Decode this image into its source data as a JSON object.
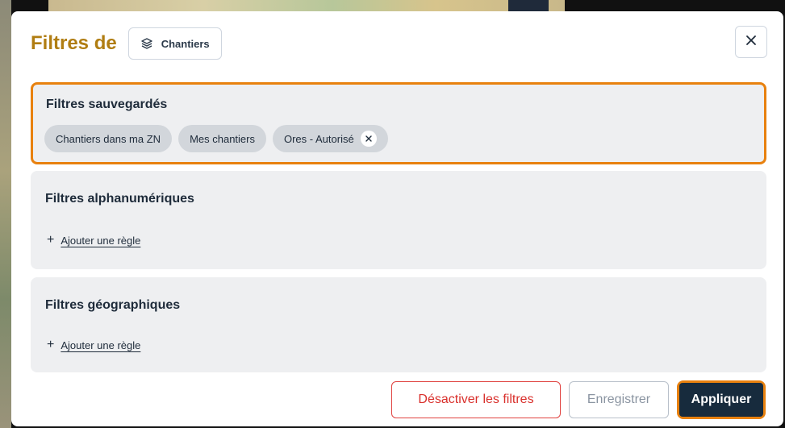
{
  "header": {
    "title": "Filtres de",
    "layer_chip_label": "Chantiers",
    "close_label": "×"
  },
  "saved_filters": {
    "title": "Filtres sauvegardés",
    "tags": [
      {
        "label": "Chantiers dans ma ZN",
        "removable": false
      },
      {
        "label": "Mes chantiers",
        "removable": false
      },
      {
        "label": "Ores - Autorisé",
        "removable": true
      }
    ]
  },
  "alphanumeric_filters": {
    "title": "Filtres alphanumériques",
    "add_rule_label": "Ajouter une règle"
  },
  "geographic_filters": {
    "title": "Filtres géographiques",
    "add_rule_label": "Ajouter une règle"
  },
  "footer": {
    "disable_label": "Désactiver les filtres",
    "save_label": "Enregistrer",
    "apply_label": "Appliquer"
  },
  "colors": {
    "title": "#b07d12",
    "highlight": "#e8810f",
    "primary": "#172b3d",
    "danger": "#d9302c"
  }
}
